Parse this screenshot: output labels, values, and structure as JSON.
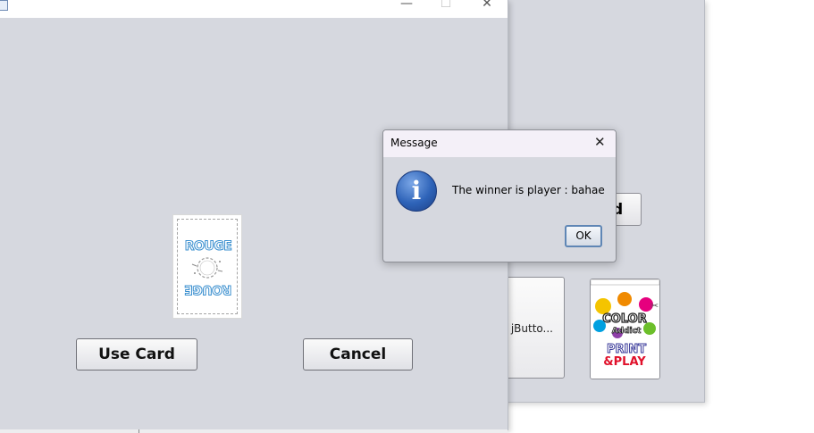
{
  "back_window": {
    "partial_button_text": "d",
    "jbutton_label": "jButto...",
    "card_art": {
      "line1": "COLOR",
      "line2": "Addict",
      "line3": "PRINT",
      "line4": "&PLAY"
    }
  },
  "main_window": {
    "title_controls": {
      "minimize": "—",
      "maximize": "☐",
      "close": "✕"
    },
    "card": {
      "top_text": "ROUGE",
      "bottom_text": "ROUGE"
    },
    "buttons": {
      "use_card": "Use Card",
      "cancel": "Cancel"
    }
  },
  "dialog": {
    "title": "Message",
    "close": "✕",
    "icon": "info-icon",
    "message": "The winner is player : bahae",
    "ok": "OK"
  },
  "colors": {
    "window_bg": "#d6d8df",
    "dialog_title_bg": "#f4f0f8",
    "rouge_blue": "#3a8fcf",
    "ok_border": "#5f86b5"
  }
}
